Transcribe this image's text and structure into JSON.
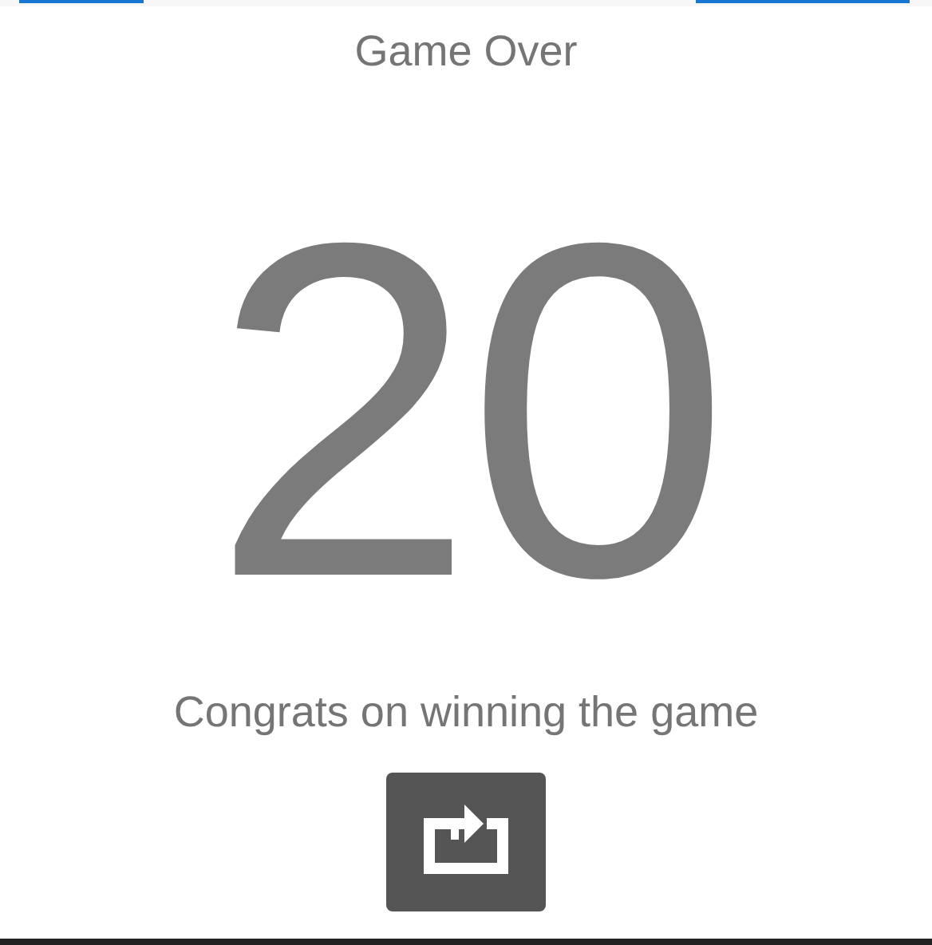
{
  "title": "Game Over",
  "score": "20",
  "message": "Congrats on winning the game"
}
